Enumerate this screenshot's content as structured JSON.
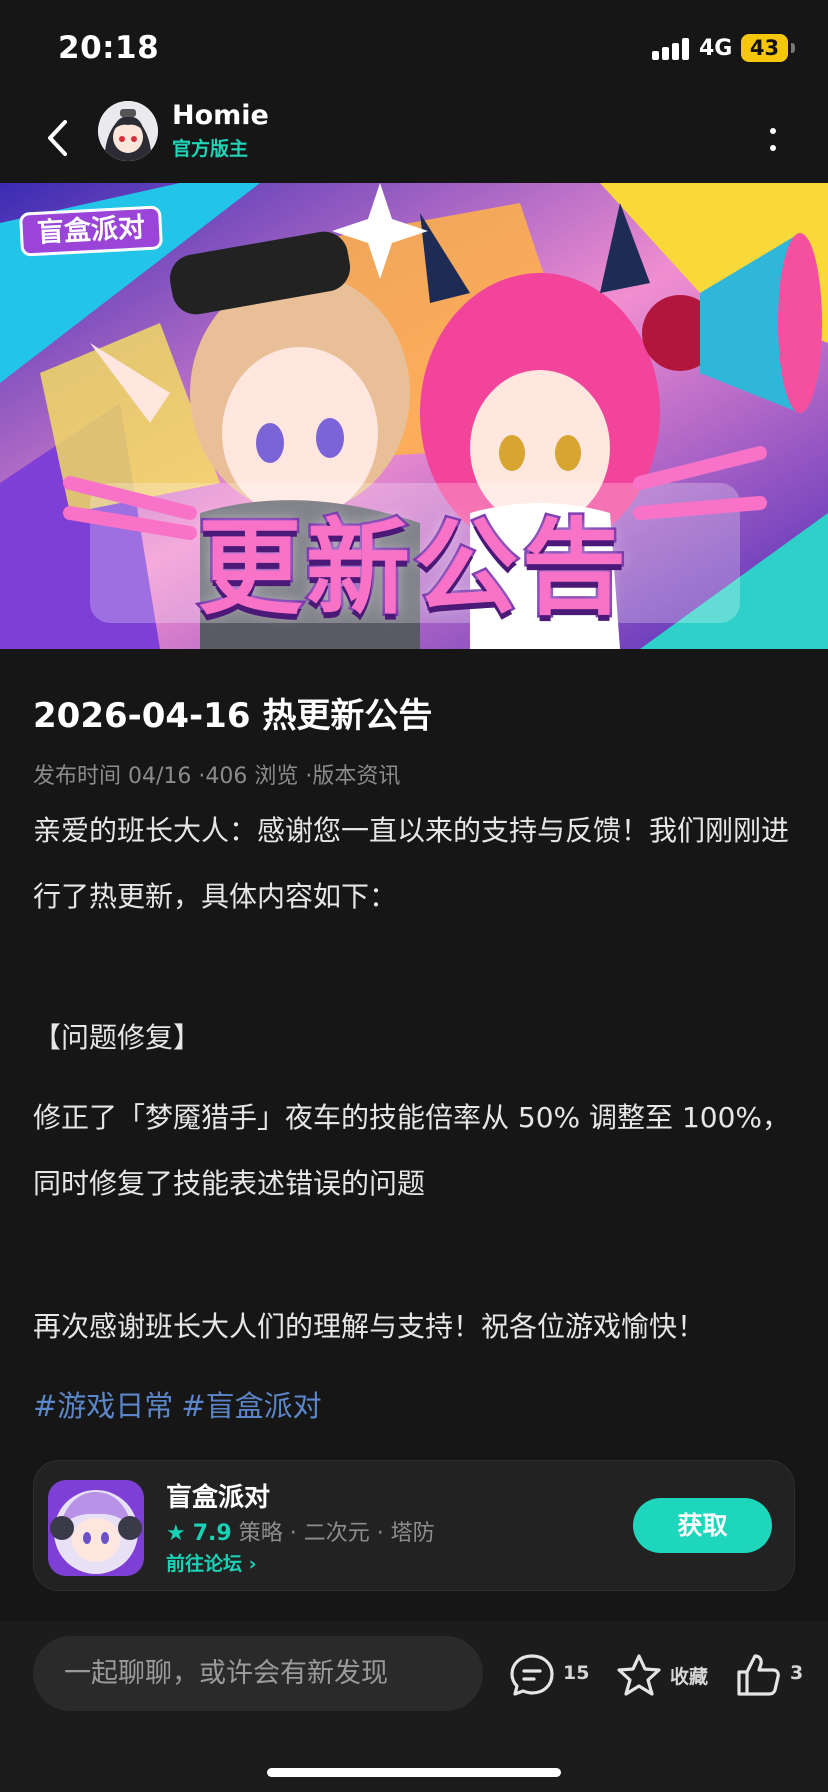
{
  "status_bar": {
    "time": "20:18",
    "network": "4G",
    "battery": "43"
  },
  "header": {
    "author_name": "Homie",
    "author_role": "官方版主"
  },
  "banner": {
    "logo_text": "盲盒派对",
    "title": "更新公告"
  },
  "article": {
    "title": "2026-04-16 热更新公告",
    "meta": "发布时间 04/16 ·406 浏览 ·版本资讯",
    "paragraphs": [
      "亲爱的班长大人：感谢您一直以来的支持与反馈！我们刚刚进行了热更新，具体内容如下：",
      "【问题修复】",
      "修正了「梦魇猎手」夜车的技能倍率从 50% 调整至 100%，同时修复了技能表述错误的问题",
      "再次感谢班长大人们的理解与支持！祝各位游戏愉快！"
    ],
    "tags": [
      "#游戏日常",
      "#盲盒派对"
    ]
  },
  "game_card": {
    "name": "盲盒派对",
    "rating": "7.9",
    "genres": "策略 · 二次元 · 塔防",
    "forum_link": "前往论坛",
    "get_label": "获取"
  },
  "bottom_bar": {
    "comment_placeholder": "一起聊聊，或许会有新发现",
    "comment_count": "15",
    "favorite_label": "收藏",
    "like_count": "3"
  },
  "colors": {
    "accent": "#1dd6bc",
    "tag": "#5c86c9",
    "background": "#161616"
  }
}
